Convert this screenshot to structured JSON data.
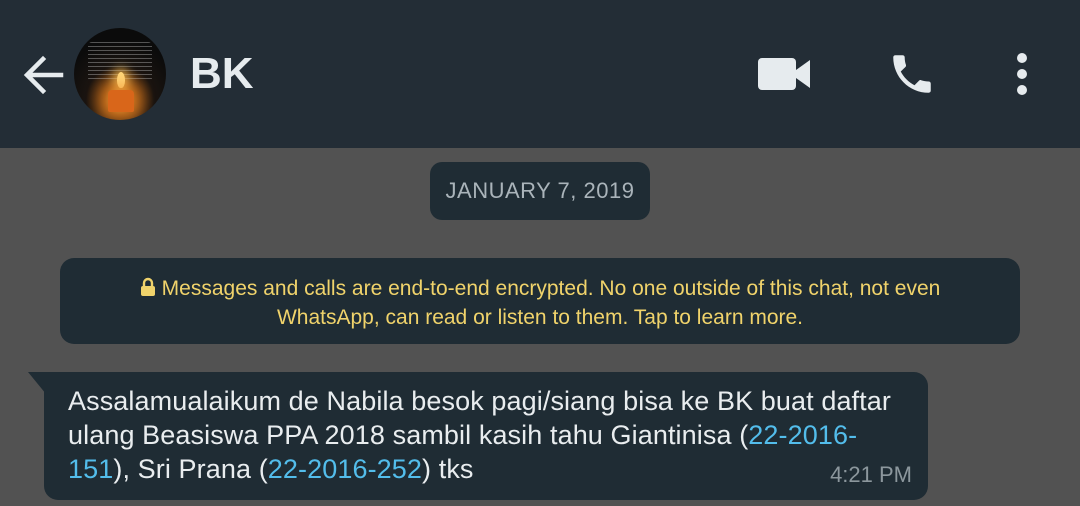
{
  "header": {
    "contact_name": "BK",
    "back_icon": "arrow-left-icon",
    "actions": [
      "video-call-icon",
      "phone-icon",
      "more-vertical-icon"
    ]
  },
  "chat": {
    "date_divider": "JANUARY 7, 2019",
    "encryption_notice": {
      "icon": "lock-icon",
      "text": "Messages and calls are end-to-end encrypted. No one outside of this chat, not even WhatsApp, can read or listen to them. Tap to learn more."
    },
    "messages": [
      {
        "sender": "incoming",
        "text_part1": "Assalamualaikum de Nabila besok pagi/siang bisa ke BK buat daftar ulang Beasiswa PPA 2018 sambil kasih tahu Giantinisa (",
        "link1": "22-2016-151",
        "text_part2": "), Sri Prana (",
        "link2": "22-2016-252",
        "text_part3": ") tks",
        "time": "4:21 PM"
      }
    ]
  },
  "colors": {
    "header_bg": "#232d36",
    "chat_bg": "#525252",
    "bubble_bg": "#1f2c34",
    "notice_text": "#f0d36b",
    "link": "#53bdeb"
  }
}
